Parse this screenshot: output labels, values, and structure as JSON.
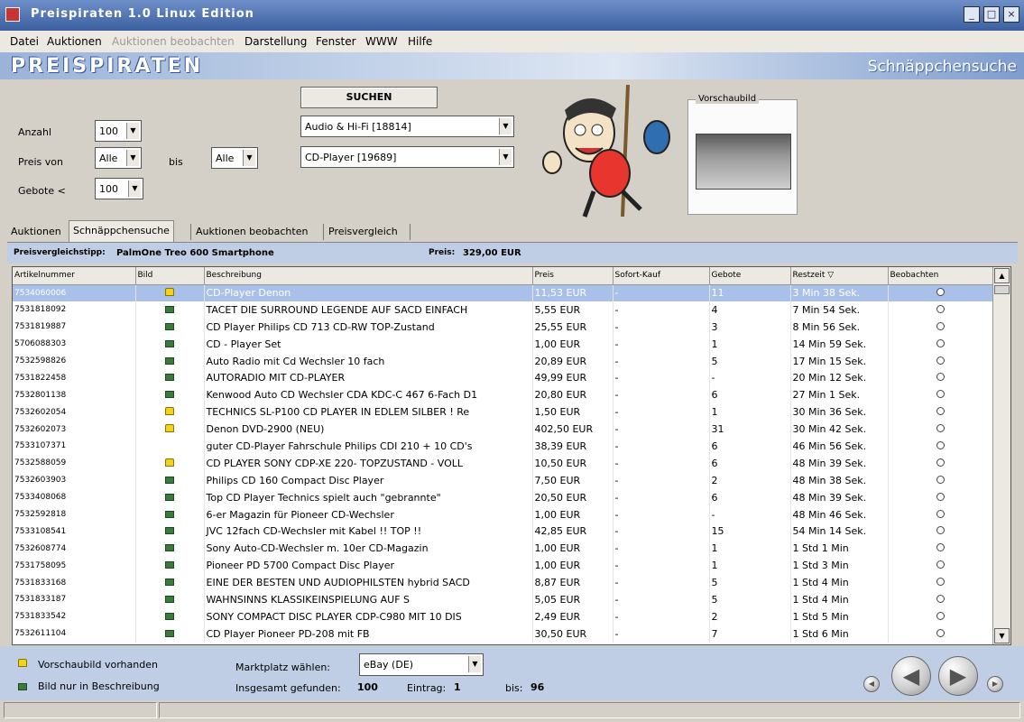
{
  "window": {
    "title": "Preispiraten 1.0 Linux Edition"
  },
  "menu": [
    "Datei",
    "Auktionen",
    "Auktionen beobachten",
    "Darstellung",
    "Fenster",
    "WWW",
    "Hilfe"
  ],
  "banner": {
    "logo": "PREISPIRATEN",
    "subtitle": "Schnäppchensuche"
  },
  "search": {
    "button": "SUCHEN",
    "count_label": "Anzahl",
    "count_value": "100",
    "price_label": "Preis von",
    "price_from": "Alle",
    "to_label": "bis",
    "price_to": "Alle",
    "bids_label": "Gebote <",
    "bids_value": "100",
    "category1": "Audio & Hi-Fi [18814]",
    "category2": "CD-Player [19689]"
  },
  "preview": {
    "label": "Vorschaubild"
  },
  "tabs": [
    "Auktionen",
    "Schnäppchensuche",
    "Auktionen beobachten",
    "Preisvergleich"
  ],
  "info": {
    "tip_label": "Preisvergleichstipp:",
    "tip_value": "PalmOne Treo 600 Smartphone",
    "price_label": "Preis:",
    "price_value": "329,00 EUR"
  },
  "table": {
    "headers": [
      "Artikelnummer",
      "Bild",
      "Beschreibung",
      "Preis",
      "Sofort-Kauf",
      "Gebote",
      "Restzeit",
      "Beobachten"
    ],
    "rows": [
      {
        "id": "7534060006",
        "img": "lock",
        "desc": "CD-Player Denon",
        "price": "11,53 EUR",
        "buy": "-",
        "bids": "11",
        "time": "3 Min 38 Sek.",
        "sel": true
      },
      {
        "id": "7531818092",
        "img": "cam",
        "desc": "TACET DIE SURROUND LEGENDE  AUF SACD EINFACH",
        "price": "5,55 EUR",
        "buy": "-",
        "bids": "4",
        "time": "7 Min 54 Sek."
      },
      {
        "id": "7531819887",
        "img": "cam",
        "desc": "CD Player Philips CD 713 CD-RW              TOP-Zustand",
        "price": "25,55 EUR",
        "buy": "-",
        "bids": "3",
        "time": "8 Min 56 Sek."
      },
      {
        "id": "5706088303",
        "img": "cam",
        "desc": "CD - Player Set",
        "price": "1,00 EUR",
        "buy": "-",
        "bids": "1",
        "time": "14 Min 59 Sek."
      },
      {
        "id": "7532598826",
        "img": "cam",
        "desc": "Auto Radio mit Cd Wechsler 10 fach",
        "price": "20,89 EUR",
        "buy": "-",
        "bids": "5",
        "time": "17 Min 15 Sek."
      },
      {
        "id": "7531822458",
        "img": "cam",
        "desc": "AUTORADIO MIT CD-PLAYER",
        "price": "49,99 EUR",
        "buy": "-",
        "bids": "-",
        "time": "20 Min 12 Sek."
      },
      {
        "id": "7532801138",
        "img": "cam",
        "desc": "Kenwood Auto CD Wechsler CDA KDC-C 467 6-Fach D1",
        "price": "20,80 EUR",
        "buy": "-",
        "bids": "6",
        "time": "27 Min 1 Sek."
      },
      {
        "id": "7532602054",
        "img": "lock",
        "desc": "TECHNICS SL-P100 CD PLAYER IN EDLEM SILBER ! Re",
        "price": "1,50 EUR",
        "buy": "-",
        "bids": "1",
        "time": "30 Min 36 Sek."
      },
      {
        "id": "7532602073",
        "img": "lock",
        "desc": "Denon DVD-2900 (NEU)",
        "price": "402,50 EUR",
        "buy": "-",
        "bids": "31",
        "time": "30 Min 42 Sek."
      },
      {
        "id": "7533107371",
        "img": "none",
        "desc": "guter CD-Player Fahrschule Philips CDI 210 + 10 CD's",
        "price": "38,39 EUR",
        "buy": "-",
        "bids": "6",
        "time": "46 Min 56 Sek."
      },
      {
        "id": "7532588059",
        "img": "lock",
        "desc": "CD PLAYER SONY CDP-XE 220- TOPZUSTAND - VOLL",
        "price": "10,50 EUR",
        "buy": "-",
        "bids": "6",
        "time": "48 Min 39 Sek."
      },
      {
        "id": "7532603903",
        "img": "cam",
        "desc": "Philips CD 160 Compact Disc Player",
        "price": "7,50 EUR",
        "buy": "-",
        "bids": "2",
        "time": "48 Min 38 Sek."
      },
      {
        "id": "7533408068",
        "img": "cam",
        "desc": "Top CD Player Technics spielt auch \"gebrannte\"",
        "price": "20,50 EUR",
        "buy": "-",
        "bids": "6",
        "time": "48 Min 39 Sek."
      },
      {
        "id": "7532592818",
        "img": "cam",
        "desc": "6-er Magazin für Pioneer CD-Wechsler",
        "price": "1,00 EUR",
        "buy": "-",
        "bids": "-",
        "time": "48 Min 46 Sek."
      },
      {
        "id": "7533108541",
        "img": "cam",
        "desc": "JVC 12fach CD-Wechsler mit Kabel !! TOP !!",
        "price": "42,85 EUR",
        "buy": "-",
        "bids": "15",
        "time": "54 Min 14 Sek."
      },
      {
        "id": "7532608774",
        "img": "cam",
        "desc": "Sony Auto-CD-Wechsler m. 10er CD-Magazin",
        "price": "1,00 EUR",
        "buy": "-",
        "bids": "1",
        "time": "1 Std 1 Min"
      },
      {
        "id": "7531758095",
        "img": "cam",
        "desc": "Pioneer PD 5700  Compact Disc Player",
        "price": "1,00 EUR",
        "buy": "-",
        "bids": "1",
        "time": "1 Std 3 Min"
      },
      {
        "id": "7531833168",
        "img": "cam",
        "desc": "EINE DER BESTEN UND AUDIOPHILSTEN  hybrid SACD",
        "price": "8,87 EUR",
        "buy": "-",
        "bids": "5",
        "time": "1 Std 4 Min"
      },
      {
        "id": "7531833187",
        "img": "cam",
        "desc": "WAHNSINNS        KLASSIKEINSPIELUNG         AUF     S",
        "price": "5,05 EUR",
        "buy": "-",
        "bids": "5",
        "time": "1 Std 4 Min"
      },
      {
        "id": "7531833542",
        "img": "cam",
        "desc": "SONY COMPACT DISC PLAYER CDP-C980  MIT 10 DIS",
        "price": "2,49 EUR",
        "buy": "-",
        "bids": "2",
        "time": "1 Std 5 Min"
      },
      {
        "id": "7532611104",
        "img": "cam",
        "desc": "CD Player Pioneer PD-208 mit FB",
        "price": "30,50 EUR",
        "buy": "-",
        "bids": "7",
        "time": "1 Std 6 Min"
      }
    ]
  },
  "bottom": {
    "legend_preview": "Vorschaubild vorhanden",
    "legend_desc": "Bild nur in Beschreibung",
    "market_label": "Marktplatz wählen:",
    "market_value": "eBay (DE)",
    "found_label": "Insgesamt gefunden:",
    "found_value": "100",
    "entry_label": "Eintrag:",
    "entry_value": "1",
    "to_label": "bis:",
    "to_value": "96"
  }
}
